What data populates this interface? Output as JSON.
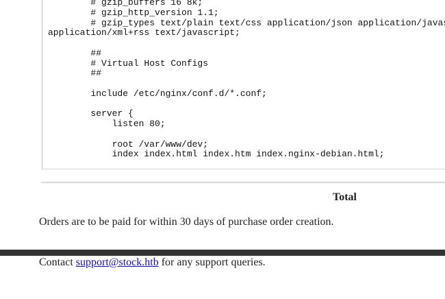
{
  "code": {
    "lines": [
      "        # gzip_buffers 16 8k;",
      "        # gzip_http_version 1.1;",
      "        # gzip_types text/plain text/css application/json application/javascript text/xml application/xml",
      "application/xml+rss text/javascript;",
      "",
      "        ##",
      "        # Virtual Host Configs",
      "        ##",
      "",
      "        include /etc/nginx/conf.d/*.conf;",
      "",
      "        server {",
      "            listen 80;",
      "",
      "            root /var/www/dev;",
      "            index index.html index.htm index.nginx-debian.html;"
    ]
  },
  "invoice": {
    "total_label": "Total",
    "terms_text": "Orders are to be paid for within 30 days of purchase order creation."
  },
  "footer": {
    "contact_prefix": "Contact ",
    "contact_email": "support@stock.htb",
    "contact_suffix": " for any support queries."
  }
}
